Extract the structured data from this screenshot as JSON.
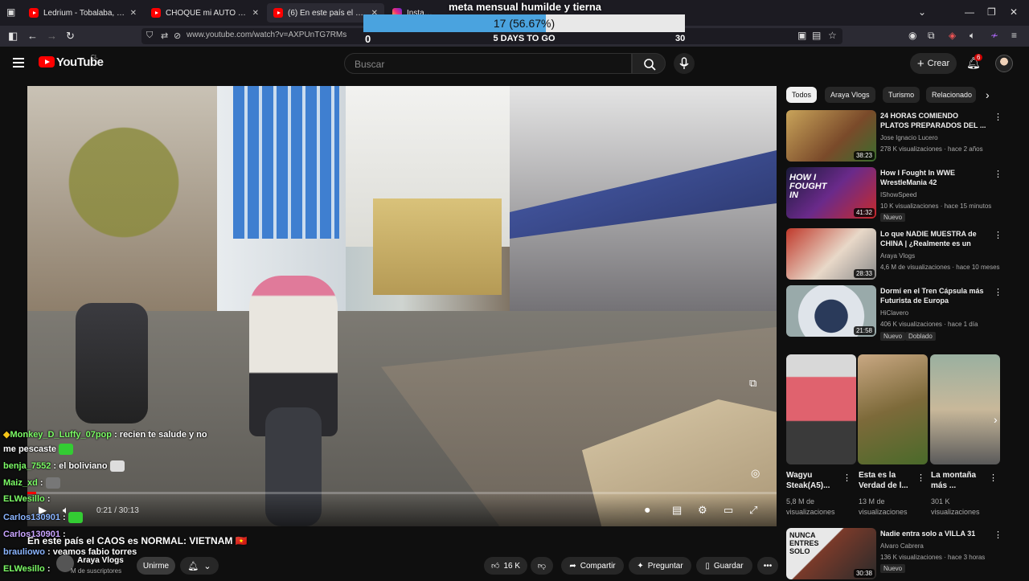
{
  "browser": {
    "tabs": [
      {
        "label": "Ledrium - Tobalaba, MUT, Av. P",
        "icon": "youtube-icon"
      },
      {
        "label": "CHOQUÉ mi AUTO 🐵 - YouTu",
        "icon": "youtube-icon"
      },
      {
        "label": "(6) En este país el CAOS es",
        "icon": "youtube-icon"
      },
      {
        "label": "Instagram",
        "icon": "instagram-icon"
      }
    ],
    "url": "www.youtube.com/watch?v=AXPUnTG7RMs"
  },
  "goal": {
    "title": "meta mensual humilde y tierna",
    "progress_text": "17 (56.67%)",
    "progress_fraction": 0.5667,
    "start": "0",
    "days_left": "5 DAYS TO GO",
    "target": "30"
  },
  "youtube": {
    "logo": "YouTube",
    "country": "CL",
    "search_placeholder": "Buscar",
    "create_label": "Crear",
    "notif_count": "6"
  },
  "player": {
    "time": "0:21 / 30:13",
    "progress_fraction": 0.012
  },
  "chat": [
    {
      "user": "Monkey_D_Luffy_07pop",
      "text": ": recien te salude y no"
    },
    {
      "user": "",
      "text": "me pescaste"
    },
    {
      "user": "benja_7552",
      "text": ": el boliviano"
    },
    {
      "user": "Maiz_xd",
      "text": ":"
    },
    {
      "user": "ELWesillo",
      "text": ":"
    },
    {
      "user": "Carlos130901",
      "text": ":"
    },
    {
      "user": "Carlos130901",
      "text": ":"
    },
    {
      "user": "brauliowo",
      "text": ": veamos fabio torres"
    },
    {
      "user": "ELWesillo",
      "text": ":"
    }
  ],
  "video": {
    "title": "En este país el CAOS es NORMAL: VIETNAM 🇻🇳",
    "channel": "Araya Vlogs",
    "subs": "M de suscriptores",
    "join": "Unirme",
    "likes": "16 K",
    "share": "Compartir",
    "ask": "Preguntar",
    "save": "Guardar"
  },
  "chips": [
    "Todos",
    "Araya Vlogs",
    "Turismo",
    "Relacionado"
  ],
  "recommendations": [
    {
      "title": "24 HORAS COMIENDO PLATOS PREPARADOS DEL ...",
      "channel": "Jose Ignacio Lucero",
      "meta": "278 K visualizaciones · hace 2 años",
      "duration": "38:23",
      "badge": ""
    },
    {
      "title": "How I Fought In WWE WrestleMania 42",
      "channel": "IShowSpeed",
      "meta": "10 K visualizaciones · hace 15 minutos",
      "duration": "41:32",
      "badge": "Nuevo"
    },
    {
      "title": "Lo que NADIE MUESTRA de CHINA | ¿Realmente es un paí...",
      "channel": "Araya Vlogs",
      "meta": "4,6 M de visualizaciones · hace 10 meses",
      "duration": "28:33",
      "badge": ""
    },
    {
      "title": "Dormí en el Tren Cápsula más Futurista de Europa",
      "channel": "HiClavero",
      "meta": "406 K visualizaciones · hace 1 día",
      "duration": "21:58",
      "badge": "Nuevo"
    },
    {
      "title": "Nadie entra solo a VILLA 31",
      "channel": "Alvaro Cabrera",
      "meta": "136 K visualizaciones · hace 3 horas",
      "duration": "30:38",
      "badge": "Nuevo"
    }
  ],
  "rec_extra_badge": "Doblado",
  "shorts": [
    {
      "title": "Wagyu Steak(A5)...",
      "views": "5,8 M de visualizaciones"
    },
    {
      "title": "Esta es la Verdad de l...",
      "views": "13 M de visualizaciones"
    },
    {
      "title": "La montaña más ...",
      "views": "301 K visualizaciones"
    }
  ],
  "thumb_texts": {
    "wwe": "HOW I FOUGHT IN",
    "villa": "NUNCA ENTRES SOLO"
  },
  "colors": {
    "accent": "#ff0000",
    "goal_fill": "#4aa3df",
    "bg": "#0f0f0f"
  }
}
